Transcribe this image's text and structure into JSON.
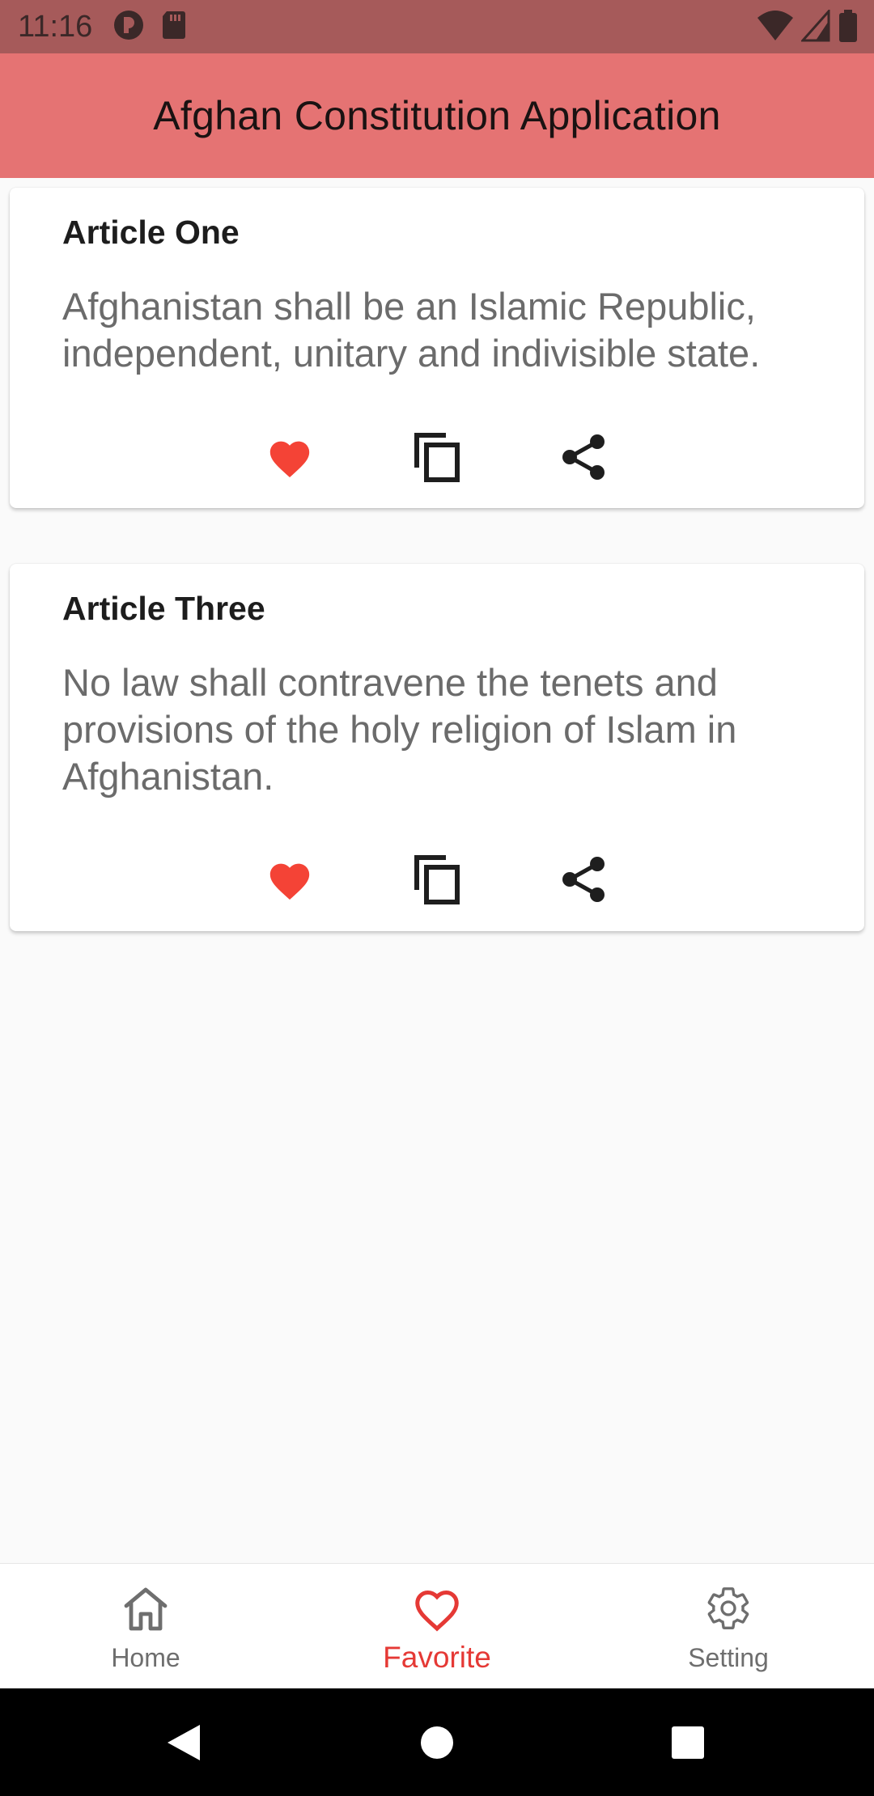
{
  "status_bar": {
    "time": "11:16"
  },
  "app_bar": {
    "title": "Afghan Constitution Application"
  },
  "articles": [
    {
      "title": "Article One",
      "text": "Afghanistan shall be an Islamic Republic, independent, unitary and indivisible state."
    },
    {
      "title": "Article Three",
      "text": "No law shall contravene the tenets and provisions of the holy religion of Islam in Afghanistan."
    }
  ],
  "bottom_nav": {
    "items": [
      {
        "label": "Home",
        "icon": "home-icon"
      },
      {
        "label": "Favorite",
        "icon": "heart-outline-icon",
        "active": true
      },
      {
        "label": "Setting",
        "icon": "gear-icon"
      }
    ]
  },
  "colors": {
    "status_bar": "#a65a5a",
    "app_bar": "#e57373",
    "favorite_red": "#f44336",
    "active_nav": "#e53935"
  }
}
